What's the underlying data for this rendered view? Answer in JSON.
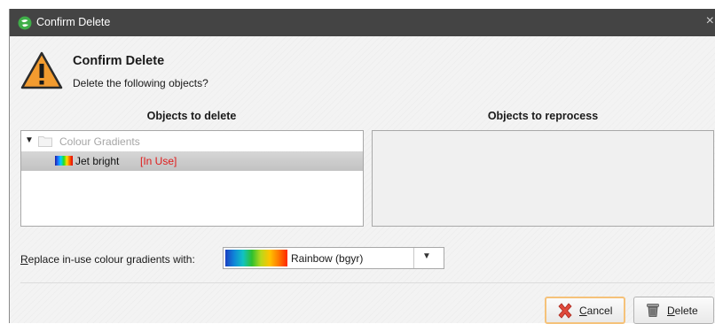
{
  "window": {
    "title": "Confirm Delete",
    "close_glyph": "×"
  },
  "header": {
    "icon": "warning-icon",
    "title": "Confirm Delete",
    "subtitle": "Delete the following objects?"
  },
  "columns": {
    "delete_heading": "Objects to delete",
    "reprocess_heading": "Objects to reprocess"
  },
  "tree": {
    "parent": {
      "label": "Colour Gradients",
      "icon": "folder-icon",
      "expanded": true
    },
    "items": [
      {
        "label": "Jet bright",
        "status": "[In Use]",
        "icon": "gradient-swatch-icon",
        "selected": true
      }
    ]
  },
  "reprocess_items": [],
  "replace": {
    "label": "Replace in-use colour gradients with:",
    "selected": "Rainbow (bgyr)"
  },
  "buttons": {
    "cancel": "Cancel",
    "delete": "Delete"
  },
  "colors": {
    "titlebar": "#444444",
    "in_use": "#e01b1b",
    "focus_border": "#f5c27a"
  }
}
